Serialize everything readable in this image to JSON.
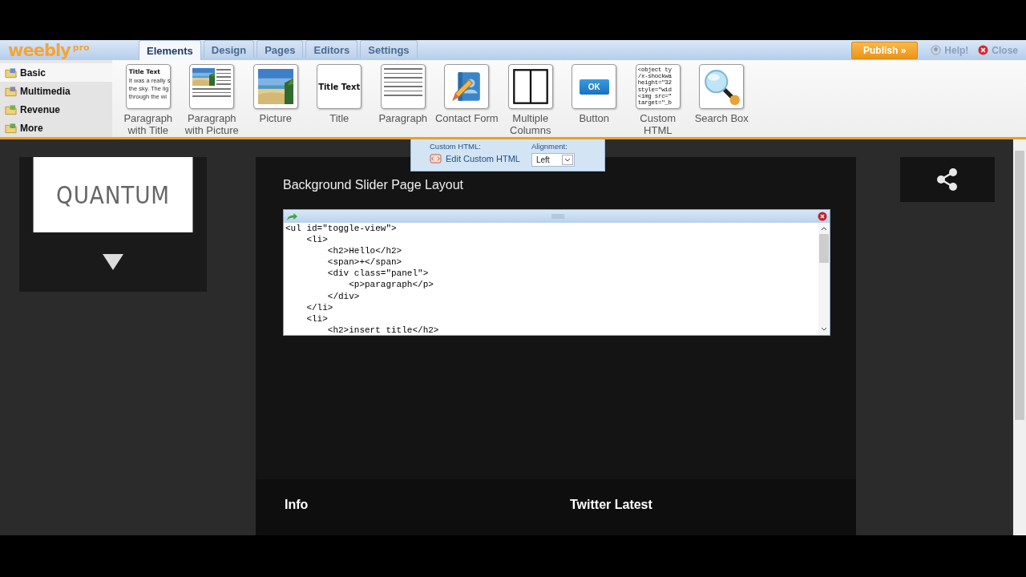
{
  "header": {
    "logo": "weebly",
    "logo_badge": "pro",
    "tabs": [
      {
        "label": "Elements",
        "selected": true
      },
      {
        "label": "Design",
        "selected": false
      },
      {
        "label": "Pages",
        "selected": false
      },
      {
        "label": "Editors",
        "selected": false
      },
      {
        "label": "Settings",
        "selected": false
      }
    ],
    "publish": "Publish »",
    "help": "Help!",
    "close": "Close"
  },
  "categories": [
    {
      "label": "Basic",
      "selected": true
    },
    {
      "label": "Multimedia",
      "selected": false
    },
    {
      "label": "Revenue",
      "selected": false
    },
    {
      "label": "More",
      "selected": false
    }
  ],
  "elements": [
    {
      "kind": "text",
      "label": "Paragraph with Title",
      "thumb_text": [
        "Title Text",
        "It was a really s",
        "the sky.  The lig",
        "through the wi"
      ]
    },
    {
      "kind": "picture-text",
      "label": "Paragraph with Picture"
    },
    {
      "kind": "picture",
      "label": "Picture"
    },
    {
      "kind": "title",
      "label": "Title",
      "thumb_text": [
        "Title Text"
      ]
    },
    {
      "kind": "paragraph",
      "label": "Paragraph"
    },
    {
      "kind": "contact",
      "label": "Contact Form"
    },
    {
      "kind": "columns",
      "label": "Multiple Columns"
    },
    {
      "kind": "button",
      "label": "Button",
      "thumb_text": [
        "OK"
      ]
    },
    {
      "kind": "code",
      "label": "Custom HTML",
      "thumb_text": [
        "<object ty",
        "/x-shockwa",
        "height=\"32",
        "style=\"wid",
        "<img src=\"",
        "target=\"_b"
      ]
    },
    {
      "kind": "search",
      "label": "Search Box"
    }
  ],
  "html_toolbar": {
    "label": "Custom HTML:",
    "edit": "Edit Custom HTML",
    "alignment_label": "Alignment:",
    "alignment": "Left"
  },
  "site": {
    "logo": "QUANTUM",
    "page_title": "Background Slider Page Layout",
    "code_lines": [
      "<ul id=\"toggle-view\">",
      "    <li>",
      "        <h2>Hello</h2>",
      "        <span>+</span>",
      "        <div class=\"panel\">",
      "            <p>paragraph</p>",
      "        </div>",
      "    </li>",
      "    <li>",
      "        <h2>insert title</h2>"
    ],
    "footer_headings": [
      "Info",
      "Twitter Latest"
    ]
  }
}
